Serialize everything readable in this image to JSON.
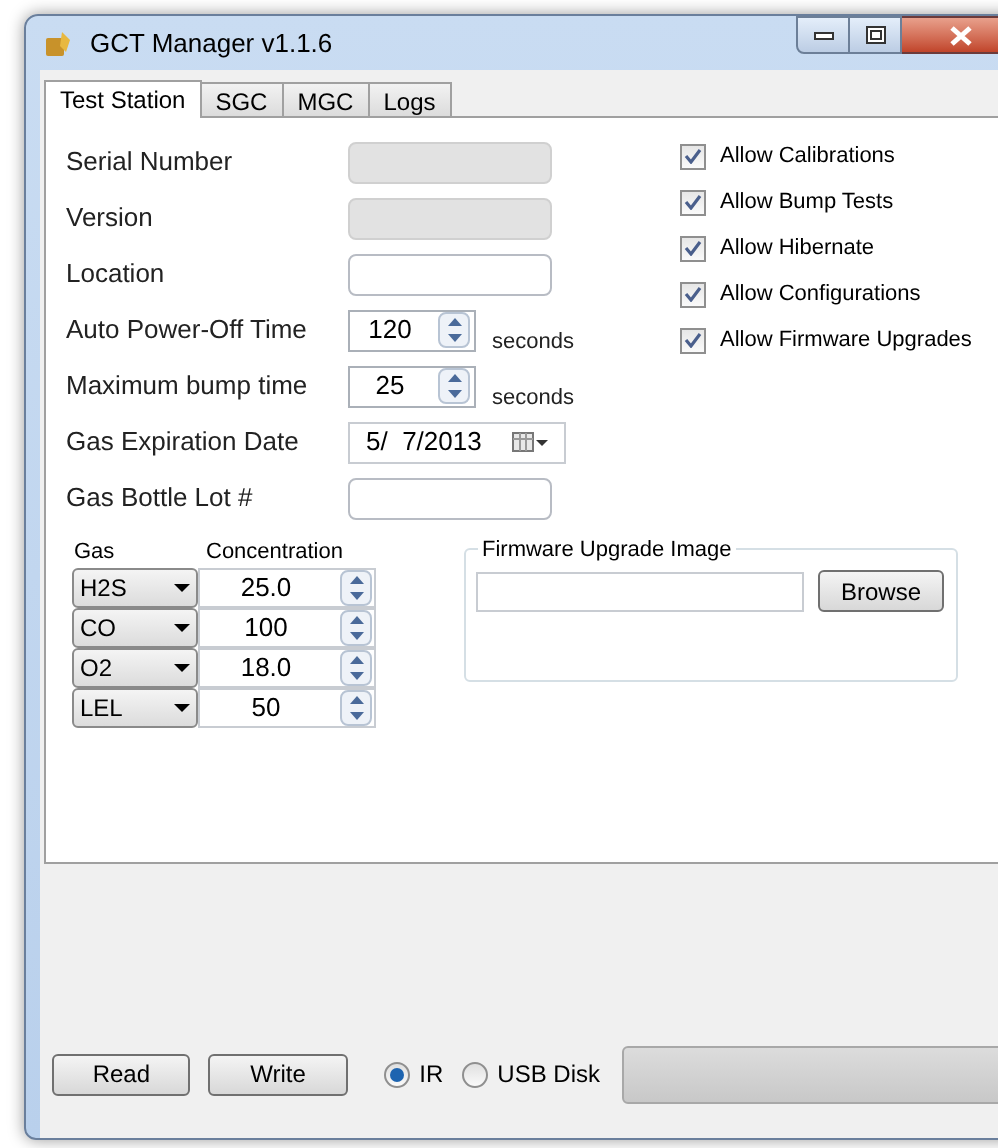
{
  "window": {
    "title": "GCT Manager v1.1.6"
  },
  "tabs": [
    {
      "label": "Test Station",
      "selected": true
    },
    {
      "label": "SGC",
      "selected": false
    },
    {
      "label": "MGC",
      "selected": false
    },
    {
      "label": "Logs",
      "selected": false
    }
  ],
  "fields": [
    {
      "kind": "text",
      "label": "Serial Number",
      "disabled": true
    },
    {
      "kind": "text",
      "label": "Version",
      "disabled": true
    },
    {
      "kind": "text",
      "label": "Location",
      "disabled": false
    },
    {
      "kind": "spin",
      "label": "Auto Power-Off Time",
      "value": "120",
      "suffix": "seconds"
    },
    {
      "kind": "spin",
      "label": "Maximum bump time",
      "value": "25",
      "suffix": "seconds"
    },
    {
      "kind": "date",
      "label": "Gas Expiration Date",
      "value": "5/  7/2013"
    },
    {
      "kind": "text",
      "label": "Gas Bottle Lot #",
      "disabled": false
    }
  ],
  "options": [
    {
      "label": "Allow Calibrations",
      "checked": true
    },
    {
      "label": "Allow Bump Tests",
      "checked": true
    },
    {
      "label": "Allow Hibernate",
      "checked": true
    },
    {
      "label": "Allow Configurations",
      "checked": true
    },
    {
      "label": "Allow Firmware Upgrades",
      "checked": true
    }
  ],
  "gas_table": {
    "columns": [
      "Gas",
      "Concentration"
    ],
    "rows": [
      {
        "gas": "H2S",
        "concentration": "25.0"
      },
      {
        "gas": "CO",
        "concentration": "100"
      },
      {
        "gas": "O2",
        "concentration": "18.0"
      },
      {
        "gas": "LEL",
        "concentration": "50"
      }
    ]
  },
  "firmware": {
    "title": "Firmware Upgrade Image",
    "button": "Browse"
  },
  "bottom": {
    "buttons": [
      "Read",
      "Write"
    ],
    "radios": [
      {
        "label": "IR",
        "selected": true
      },
      {
        "label": "USB Disk",
        "selected": false
      }
    ],
    "progress": {
      "level": 0
    }
  }
}
